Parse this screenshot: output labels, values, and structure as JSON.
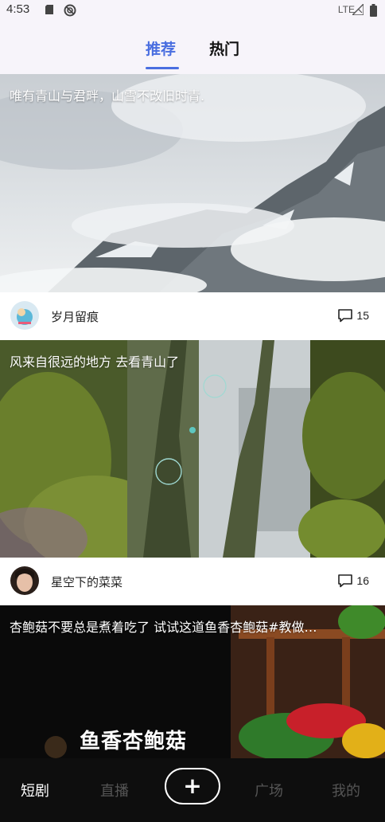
{
  "status": {
    "time": "4:53",
    "network": "LTE"
  },
  "tabs": {
    "recommend": "推荐",
    "hot": "热门"
  },
  "feed": [
    {
      "title": "唯有青山与君畔，山雪不改旧时青.",
      "author": "岁月留痕",
      "comments": "15"
    },
    {
      "title": "风来自很远的地方 去看青山了",
      "author": "星空下的菜菜",
      "comments": "16"
    },
    {
      "title": "杏鲍菇不要总是煮着吃了 试试这道鱼香杏鲍菇#教做…",
      "overlay": "鱼香杏鲍菇"
    }
  ],
  "nav": {
    "drama": "短剧",
    "live": "直播",
    "add": "+",
    "square": "广场",
    "mine": "我的"
  },
  "colors": {
    "accent": "#4a6ee0",
    "nav_bg": "#0e0e0e"
  }
}
